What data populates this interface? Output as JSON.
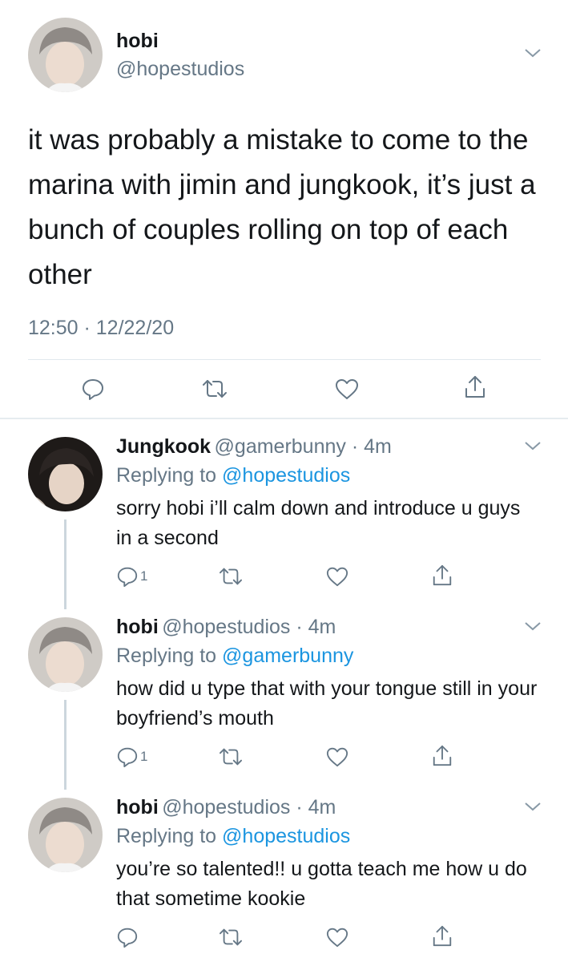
{
  "main_tweet": {
    "name": "hobi",
    "handle": "@hopestudios",
    "text": "it was probably a mistake to come to the marina with jimin and jungkook, it’s just a bunch of couples rolling on top of each other",
    "timestamp": "12:50 · 12/22/20"
  },
  "replies": [
    {
      "name": "Jungkook",
      "handle_time": "@gamerbunny · 4m",
      "replying_label": "Replying to",
      "replying_to": "@hopestudios",
      "text": "sorry hobi i’ll calm down and introduce u guys in a second",
      "reply_count": "1"
    },
    {
      "name": "hobi",
      "handle_time": "@hopestudios · 4m",
      "replying_label": "Replying to",
      "replying_to": "@gamerbunny",
      "text": "how did u type that with your tongue still in your boyfriend’s mouth",
      "reply_count": "1"
    },
    {
      "name": "hobi",
      "handle_time": "@hopestudios · 4m",
      "replying_label": "Replying to",
      "replying_to": "@hopestudios",
      "text": "you’re so talented!! u gotta teach me how u do that sometime kookie",
      "reply_count": ""
    }
  ],
  "icons": {
    "reply": "speech-bubble-icon",
    "retweet": "retweet-icon",
    "like": "heart-icon",
    "share": "share-icon",
    "menu": "chevron-down-icon"
  },
  "colors": {
    "link": "#1b95e0",
    "secondary_text": "#657786",
    "divider": "#e1e8ed"
  }
}
